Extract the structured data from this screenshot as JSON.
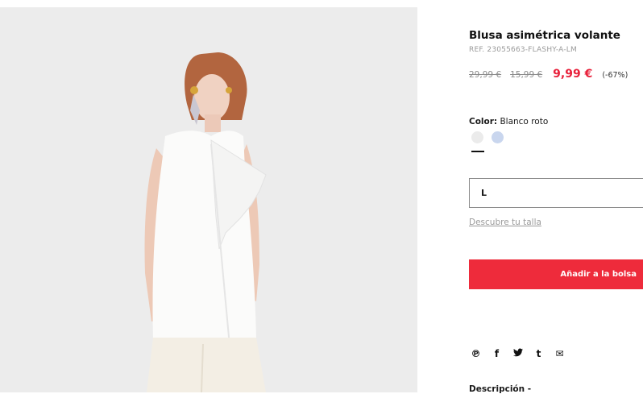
{
  "product": {
    "title": "Blusa asimétrica volante",
    "ref": "REF. 23055663-FLASHY-A-LM",
    "original_price": "29,99 €",
    "previous_price": "15,99 €",
    "sale_price": "9,99 €",
    "discount": "(-67%)"
  },
  "color": {
    "label": "Color:",
    "value": "Blanco roto",
    "swatches": [
      {
        "name": "Blanco roto",
        "hex": "#ebebeb",
        "selected": true
      },
      {
        "name": "Azul",
        "hex": "#c9d6ee",
        "selected": false
      }
    ]
  },
  "size": {
    "selected": "L",
    "guide_link": "Descubre tu talla"
  },
  "actions": {
    "add_to_bag": "Añadir a la bolsa"
  },
  "share": {
    "icons": [
      "pinterest-icon",
      "facebook-icon",
      "twitter-icon",
      "tumblr-icon",
      "email-icon"
    ],
    "glyphs": [
      "℗",
      "f",
      "🐦",
      "t",
      "✉"
    ]
  },
  "description": {
    "label": "Descripción -"
  },
  "colors": {
    "accent": "#ee2b3b",
    "sale": "#e8213b",
    "photo_bg": "#ececec"
  }
}
